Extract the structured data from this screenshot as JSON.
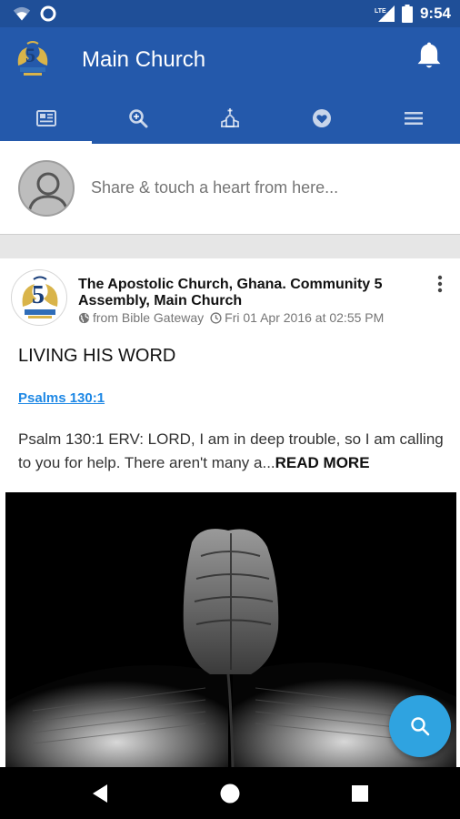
{
  "status_bar": {
    "time": "9:54",
    "icons": [
      "wifi-icon",
      "circle-app-icon",
      "lte-signal-icon",
      "battery-icon"
    ]
  },
  "app_bar": {
    "title": "Main Church",
    "logo": "church-logo-icon",
    "action_icon": "bell-icon"
  },
  "tabs": [
    {
      "name": "feed",
      "icon": "newspaper-icon",
      "active": true
    },
    {
      "name": "search",
      "icon": "search-zoom-icon",
      "active": false
    },
    {
      "name": "church",
      "icon": "church-icon",
      "active": false
    },
    {
      "name": "favorites",
      "icon": "heart-circle-icon",
      "active": false
    },
    {
      "name": "menu",
      "icon": "hamburger-menu-icon",
      "active": false
    }
  ],
  "share": {
    "placeholder": "Share & touch a heart from here..."
  },
  "post": {
    "author": "The Apostolic Church, Ghana. Community 5 Assembly, Main Church",
    "source": "from Bible Gateway",
    "timestamp": "Fri 01 Apr 2016 at 02:55 PM",
    "title": "LIVING HIS WORD",
    "link": "Psalms 130:1",
    "excerpt": "Psalm 130:1 ERV: LORD, I am in deep trouble, so I am calling to you for help. There aren't many a...",
    "read_more": "READ MORE"
  },
  "colors": {
    "status_bar": "#1f4f98",
    "app_bar": "#2459ab",
    "link": "#1e88e5",
    "fab": "#2fa3e0"
  }
}
